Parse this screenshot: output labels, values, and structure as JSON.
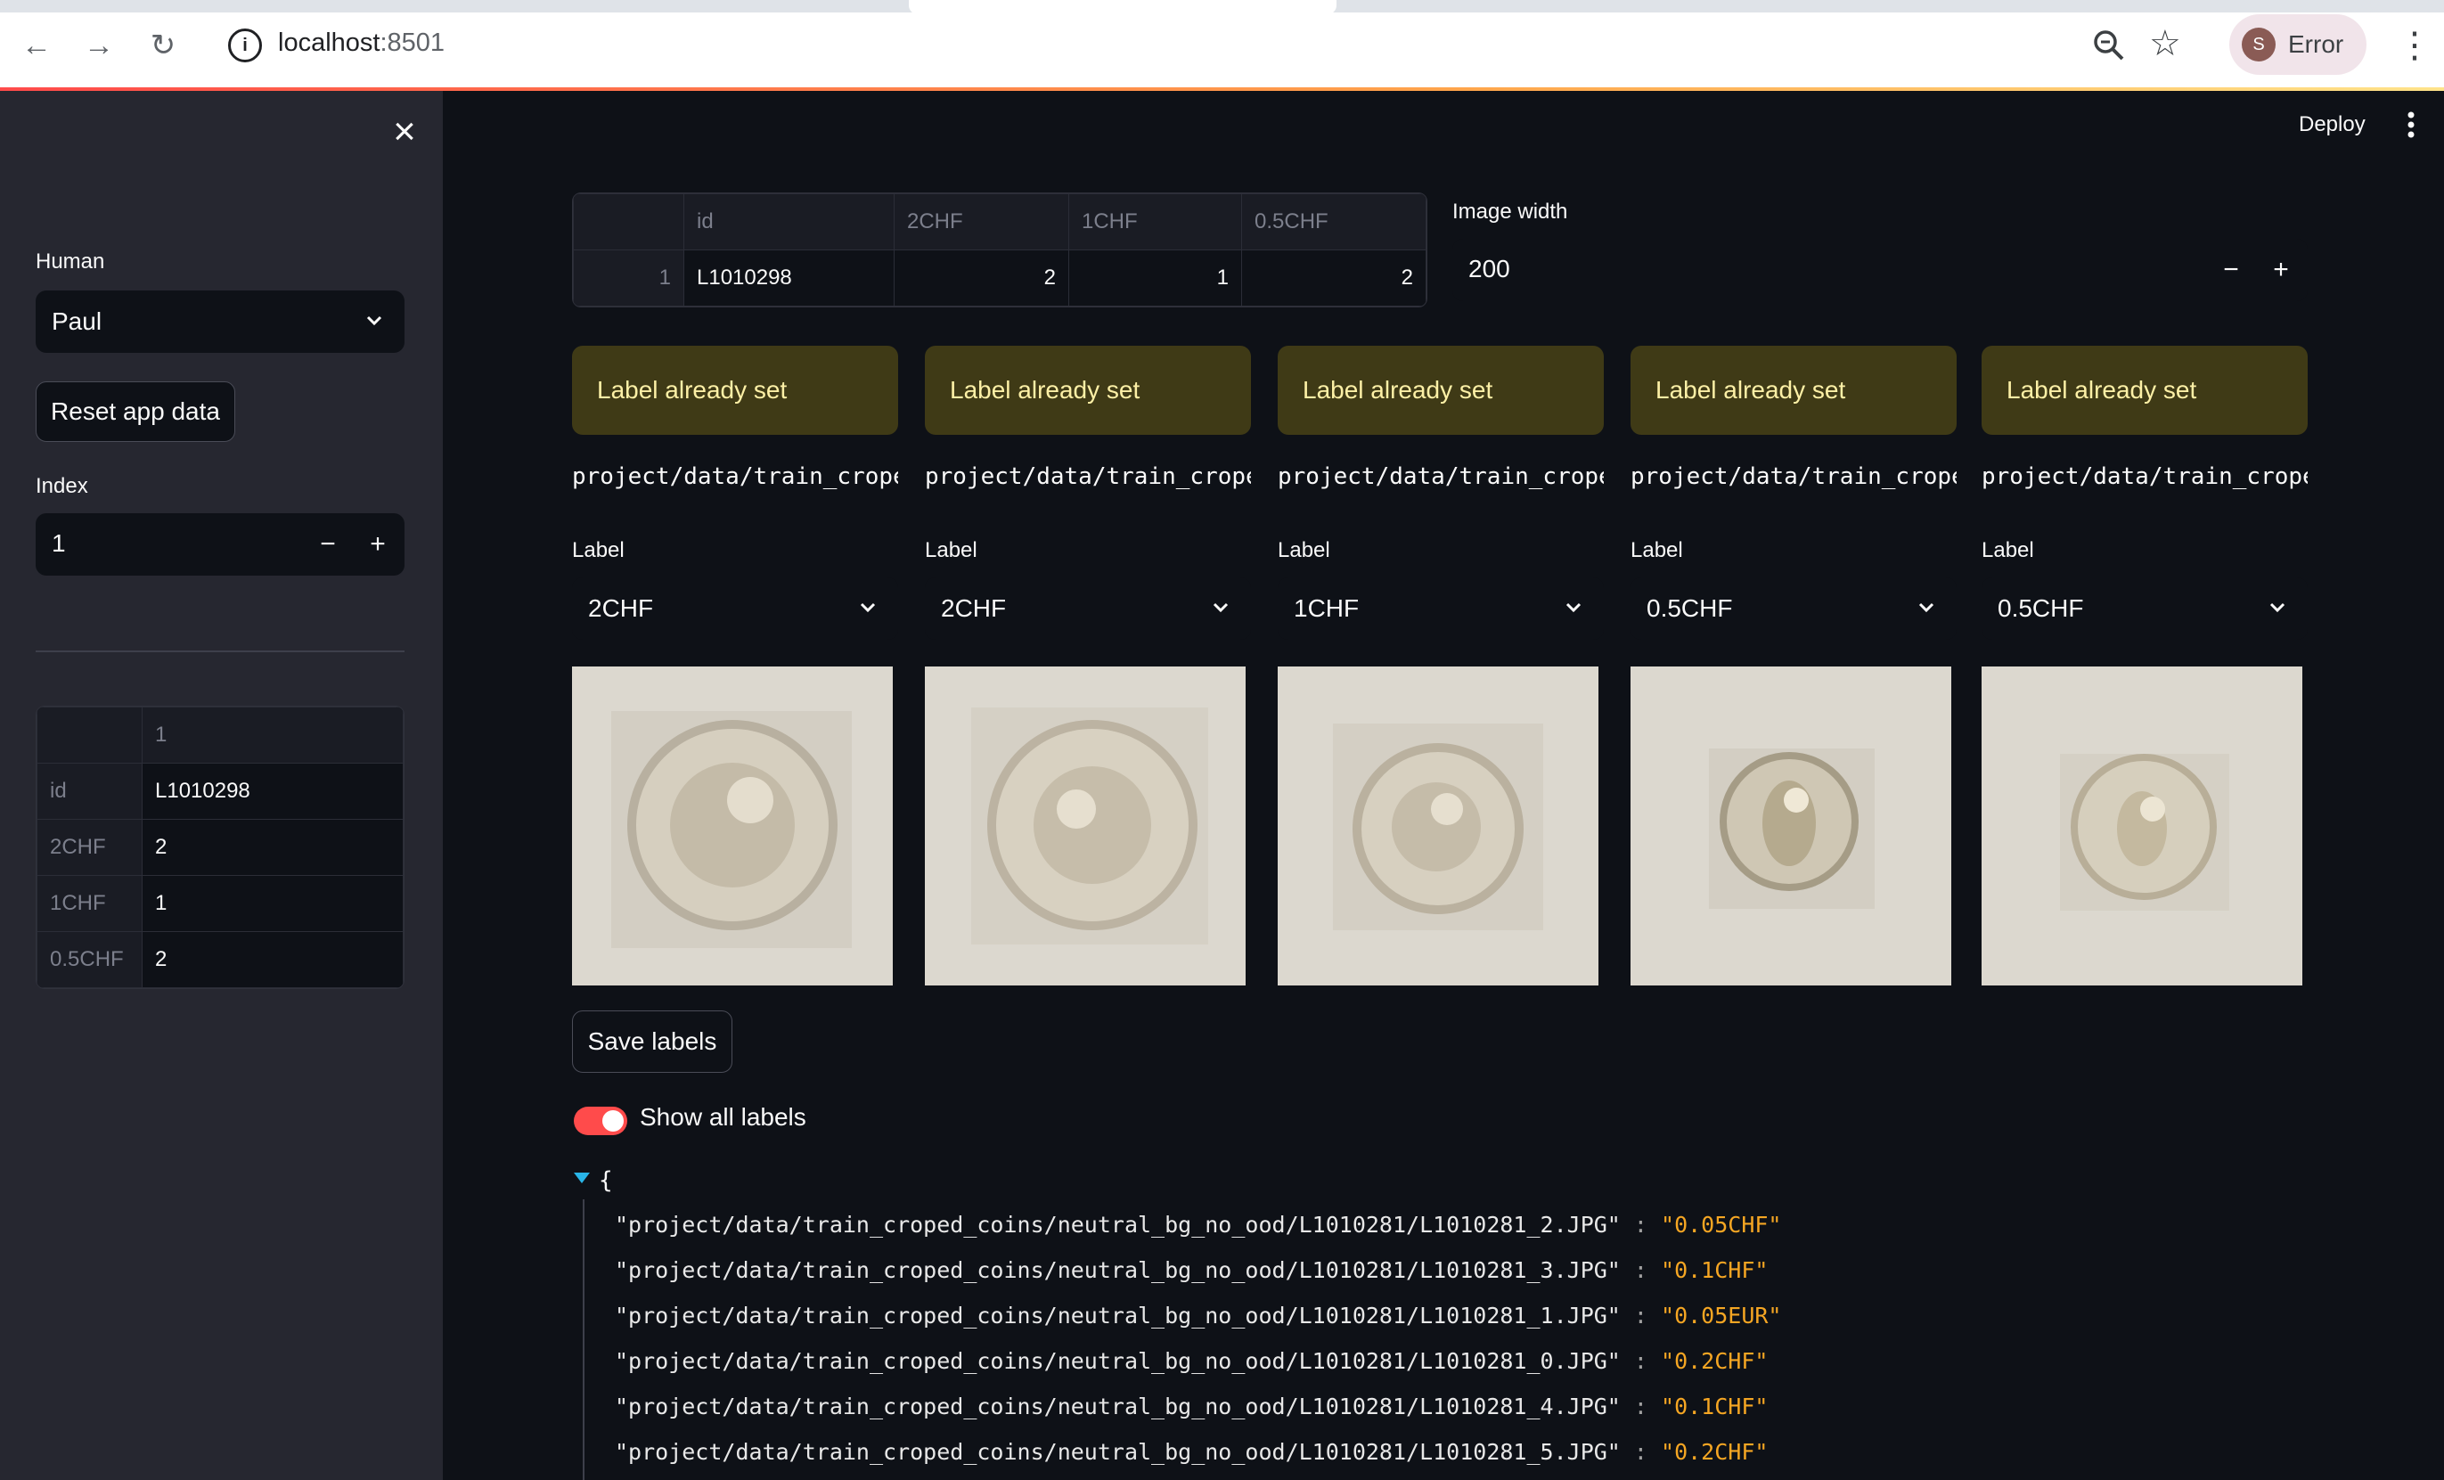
{
  "browser": {
    "url_host": "localhost",
    "url_port": ":8501",
    "profile_initial": "S",
    "profile_label": "Error"
  },
  "sidebar": {
    "human_label": "Human",
    "human_value": "Paul",
    "reset_button": "Reset app data",
    "index_label": "Index",
    "index_value": "1",
    "summary_table": {
      "header": [
        "",
        "1"
      ],
      "rows": [
        [
          "id",
          "L1010298"
        ],
        [
          "2CHF",
          "2"
        ],
        [
          "1CHF",
          "1"
        ],
        [
          "0.5CHF",
          "2"
        ]
      ]
    }
  },
  "header": {
    "deploy_label": "Deploy"
  },
  "top_table": {
    "columns": [
      "",
      "id",
      "2CHF",
      "1CHF",
      "0.5CHF"
    ],
    "row": [
      "1",
      "L1010298",
      "2",
      "1",
      "2"
    ]
  },
  "image_width": {
    "label": "Image width",
    "value": "200"
  },
  "images": [
    {
      "status": "Label already set",
      "path": "project/data/train_croped_coins/neutral_bg_no_ood/L1010298/L1010298_0.JPG",
      "label_caption": "Label",
      "label": "2CHF"
    },
    {
      "status": "Label already set",
      "path": "project/data/train_croped_coins/neutral_bg_no_ood/L1010298/L1010298_1.JPG",
      "label_caption": "Label",
      "label": "2CHF"
    },
    {
      "status": "Label already set",
      "path": "project/data/train_croped_coins/neutral_bg_no_ood/L1010298/L1010298_2.JPG",
      "label_caption": "Label",
      "label": "1CHF"
    },
    {
      "status": "Label already set",
      "path": "project/data/train_croped_coins/neutral_bg_no_ood/L1010298/L1010298_3.JPG",
      "label_caption": "Label",
      "label": "0.5CHF"
    },
    {
      "status": "Label already set",
      "path": "project/data/train_croped_coins/neutral_bg_no_ood/L1010298/L1010298_4.JPG",
      "label_caption": "Label",
      "label": "0.5CHF"
    }
  ],
  "save_button": "Save labels",
  "show_all_toggle": {
    "label": "Show all labels",
    "on": true
  },
  "json_view": {
    "open_brace": "{",
    "entries": [
      {
        "key": "\"project/data/train_croped_coins/neutral_bg_no_ood/L1010281/L1010281_2.JPG\"",
        "value": "\"0.05CHF\""
      },
      {
        "key": "\"project/data/train_croped_coins/neutral_bg_no_ood/L1010281/L1010281_3.JPG\"",
        "value": "\"0.1CHF\""
      },
      {
        "key": "\"project/data/train_croped_coins/neutral_bg_no_ood/L1010281/L1010281_1.JPG\"",
        "value": "\"0.05EUR\""
      },
      {
        "key": "\"project/data/train_croped_coins/neutral_bg_no_ood/L1010281/L1010281_0.JPG\"",
        "value": "\"0.2CHF\""
      },
      {
        "key": "\"project/data/train_croped_coins/neutral_bg_no_ood/L1010281/L1010281_4.JPG\"",
        "value": "\"0.1CHF\""
      },
      {
        "key": "\"project/data/train_croped_coins/neutral_bg_no_ood/L1010281/L1010281_5.JPG\"",
        "value": "\"0.2CHF\""
      }
    ]
  },
  "colors": {
    "accent": "#ff4b4b",
    "warning_bg": "#3f3a16",
    "json_value": "#f5a623"
  }
}
